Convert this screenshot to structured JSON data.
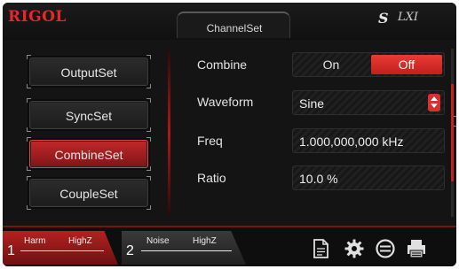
{
  "brand": "RIGOL",
  "window_title": "ChannelSet",
  "status": {
    "sync_icon": "S",
    "lxi_icon": "LXI"
  },
  "menu": [
    {
      "label": "OutputSet",
      "active": false
    },
    {
      "label": "SyncSet",
      "active": false
    },
    {
      "label": "CombineSet",
      "active": true
    },
    {
      "label": "CoupleSet",
      "active": false
    }
  ],
  "params": {
    "combine": {
      "label": "Combine",
      "on": "On",
      "off": "Off",
      "selected": "Off"
    },
    "waveform": {
      "label": "Waveform",
      "value": "Sine"
    },
    "freq": {
      "label": "Freq",
      "value": "1.000,000,000 kHz"
    },
    "ratio": {
      "label": "Ratio",
      "value": "10.0 %"
    }
  },
  "channels": [
    {
      "number": "1",
      "param_a": "Harm",
      "param_b": "HighZ",
      "active": true
    },
    {
      "number": "2",
      "param_a": "Noise",
      "param_b": "HighZ",
      "active": false
    }
  ],
  "tools": [
    "file-icon",
    "gear-icon",
    "link-icon",
    "print-icon"
  ],
  "colors": {
    "accent": "#d8302d",
    "background": "#141414"
  }
}
